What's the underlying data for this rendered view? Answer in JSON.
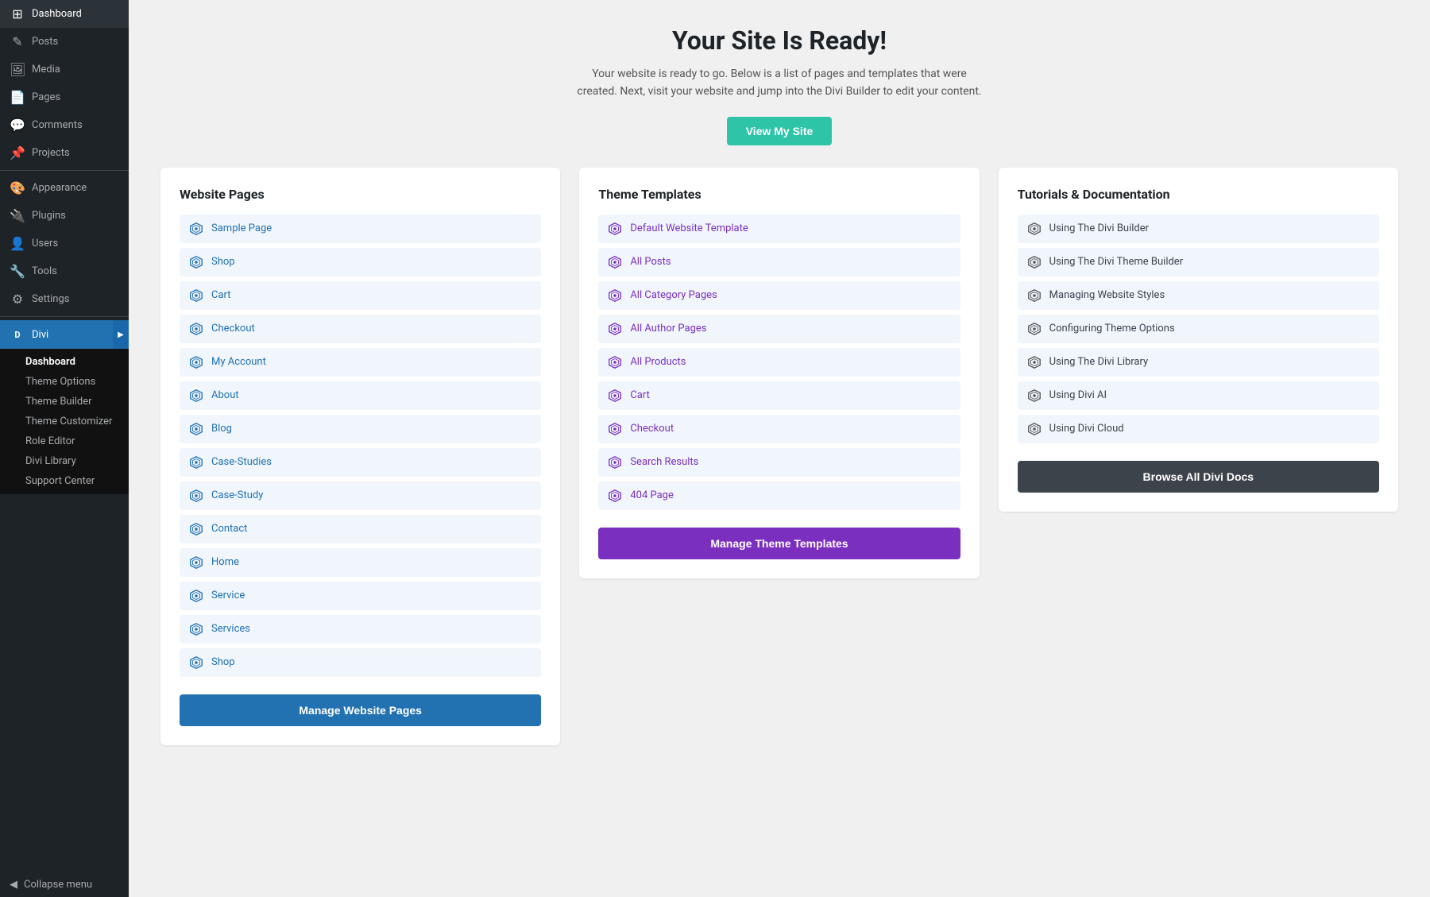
{
  "sidebar": {
    "items": [
      {
        "id": "dashboard",
        "label": "Dashboard",
        "icon": "⊞"
      },
      {
        "id": "posts",
        "label": "Posts",
        "icon": "📝"
      },
      {
        "id": "media",
        "label": "Media",
        "icon": "🖼"
      },
      {
        "id": "pages",
        "label": "Pages",
        "icon": "📄"
      },
      {
        "id": "comments",
        "label": "Comments",
        "icon": "💬"
      },
      {
        "id": "projects",
        "label": "Projects",
        "icon": "📌"
      },
      {
        "id": "appearance",
        "label": "Appearance",
        "icon": "🎨"
      },
      {
        "id": "plugins",
        "label": "Plugins",
        "icon": "🔌"
      },
      {
        "id": "users",
        "label": "Users",
        "icon": "👤"
      },
      {
        "id": "tools",
        "label": "Tools",
        "icon": "🔧"
      },
      {
        "id": "settings",
        "label": "Settings",
        "icon": "⚙"
      }
    ],
    "divi": {
      "label": "Divi",
      "submenu": [
        {
          "id": "dashboard",
          "label": "Dashboard",
          "active": true
        },
        {
          "id": "theme-options",
          "label": "Theme Options"
        },
        {
          "id": "theme-builder",
          "label": "Theme Builder"
        },
        {
          "id": "theme-customizer",
          "label": "Theme Customizer"
        },
        {
          "id": "role-editor",
          "label": "Role Editor"
        },
        {
          "id": "divi-library",
          "label": "Divi Library"
        },
        {
          "id": "support-center",
          "label": "Support Center"
        }
      ]
    },
    "collapse_menu": "Collapse menu"
  },
  "main": {
    "title": "Your Site Is Ready!",
    "subtitle": "Your website is ready to go. Below is a list of pages and templates that were created. Next, visit your website and jump into the Divi Builder to edit your content.",
    "view_site_btn": "View My Site",
    "website_pages": {
      "heading": "Website Pages",
      "items": [
        "Sample Page",
        "Shop",
        "Cart",
        "Checkout",
        "My Account",
        "About",
        "Blog",
        "Case-Studies",
        "Case-Study",
        "Contact",
        "Home",
        "Service",
        "Services",
        "Shop"
      ],
      "manage_btn": "Manage Website Pages"
    },
    "theme_templates": {
      "heading": "Theme Templates",
      "items": [
        "Default Website Template",
        "All Posts",
        "All Category Pages",
        "All Author Pages",
        "All Products",
        "Cart",
        "Checkout",
        "Search Results",
        "404 Page"
      ],
      "manage_btn": "Manage Theme Templates"
    },
    "tutorials": {
      "heading": "Tutorials & Documentation",
      "items": [
        "Using The Divi Builder",
        "Using The Divi Theme Builder",
        "Managing Website Styles",
        "Configuring Theme Options",
        "Using The Divi Library",
        "Using Divi AI",
        "Using Divi Cloud"
      ],
      "browse_btn": "Browse All Divi Docs"
    }
  },
  "colors": {
    "teal": "#2ec4a7",
    "blue": "#2271b1",
    "purple": "#7b2fbe",
    "dark": "#3c434a"
  }
}
